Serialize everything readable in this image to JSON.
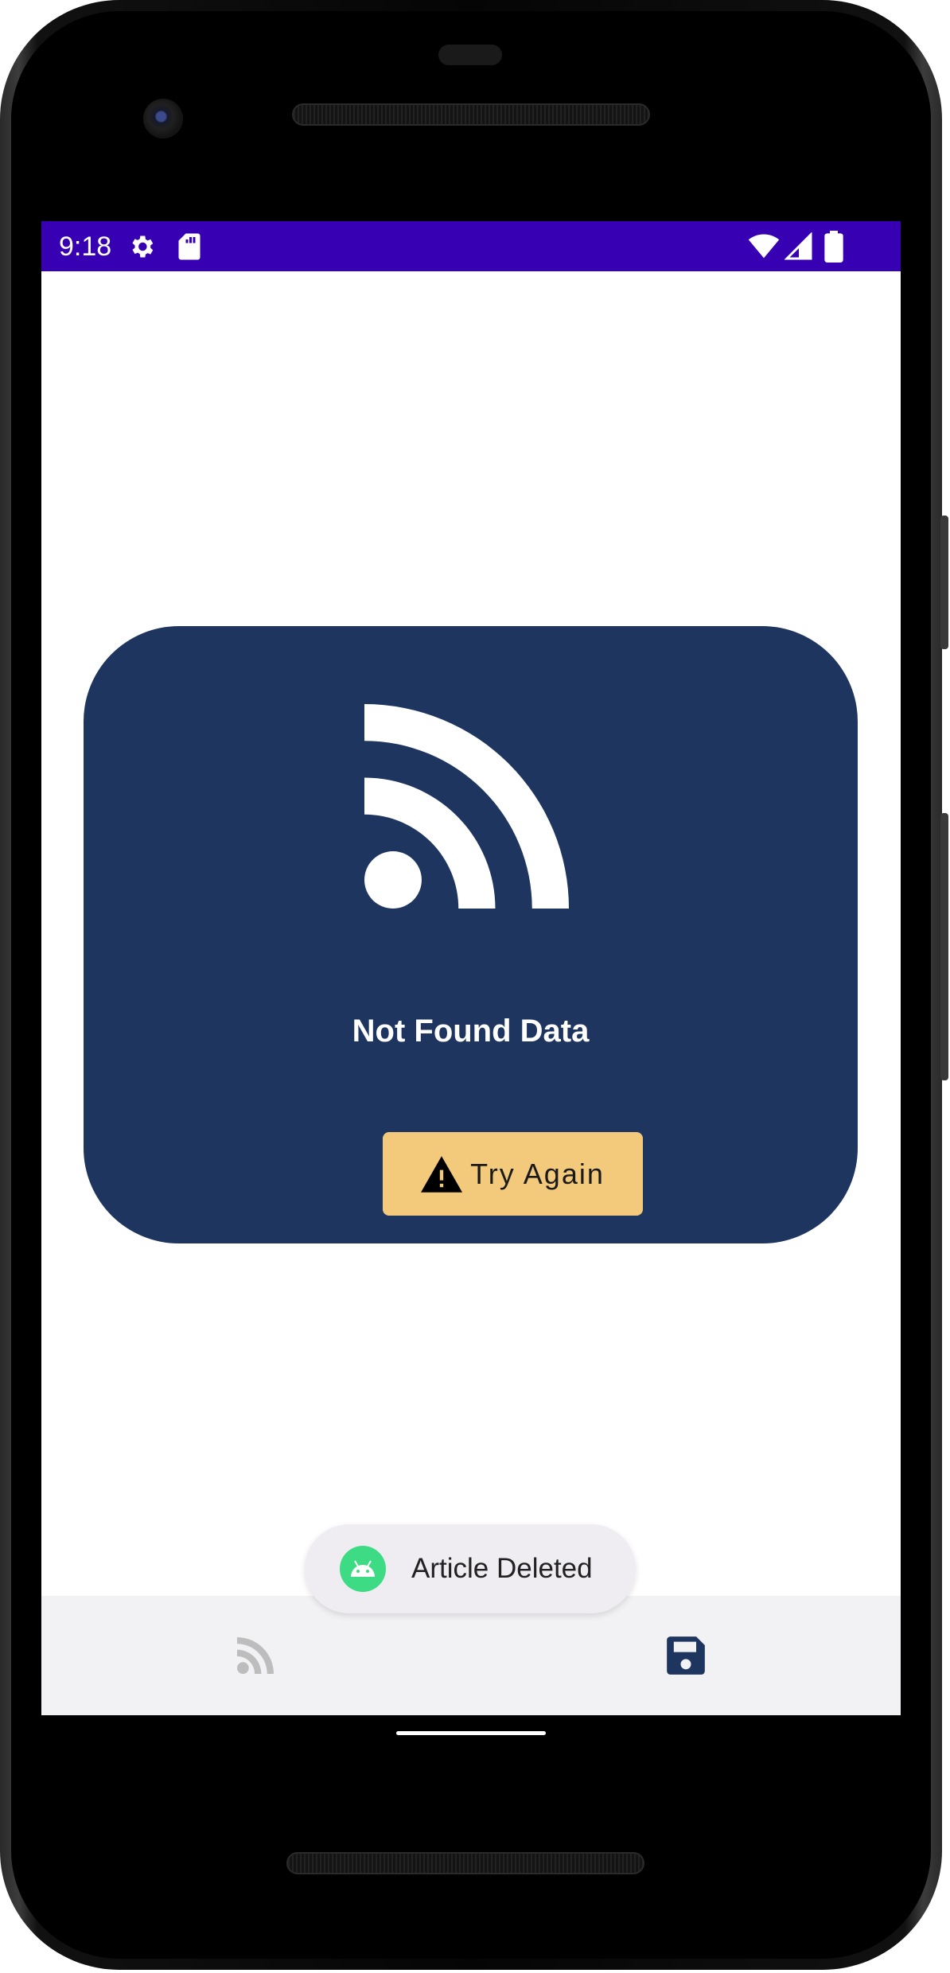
{
  "status_bar": {
    "time": "9:18",
    "background": "#3700b3",
    "icons": [
      "settings-icon",
      "sd-card-icon",
      "wifi-icon",
      "signal-icon",
      "battery-icon"
    ]
  },
  "card": {
    "icon": "rss-feed-icon",
    "message": "Not Found Data",
    "background": "#1e3560",
    "button": {
      "label": "Try Again",
      "icon": "warning-icon",
      "background": "#f3ca7c"
    }
  },
  "toast": {
    "icon": "android-icon",
    "message": "Article Deleted"
  },
  "bottom_nav": {
    "items": [
      {
        "icon": "rss-feed-icon",
        "selected": false
      },
      {
        "icon": "save-icon",
        "selected": true
      }
    ]
  }
}
